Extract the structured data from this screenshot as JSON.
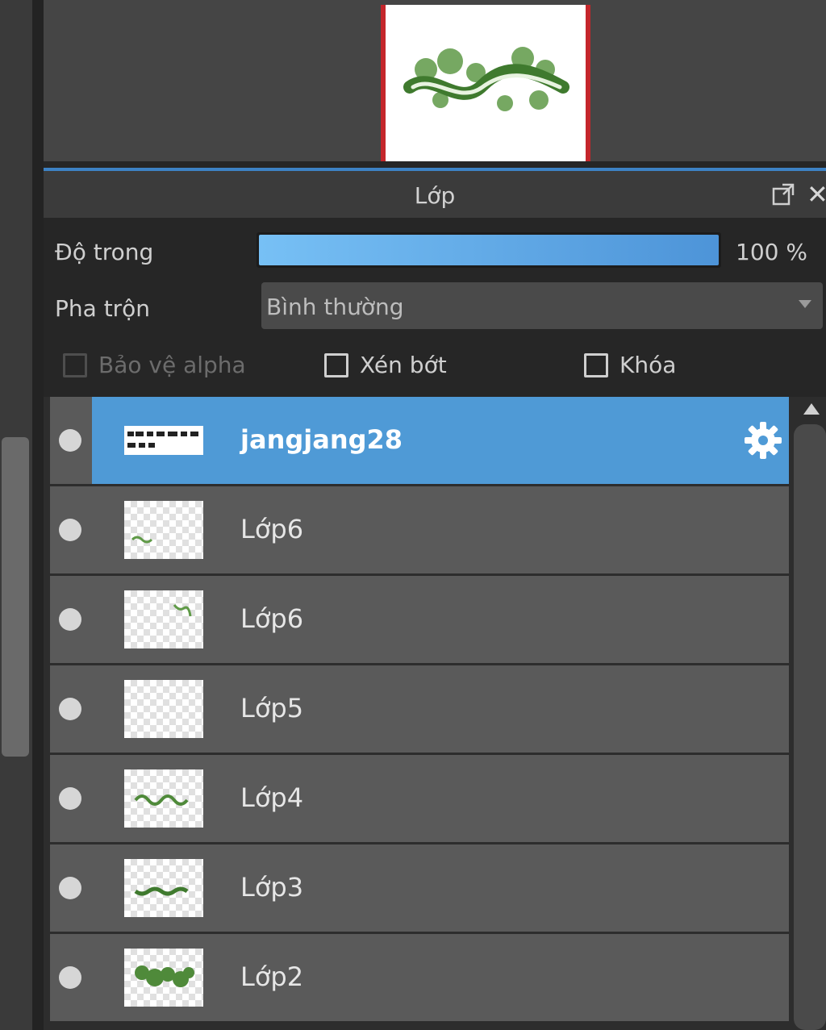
{
  "panel": {
    "title": "Lớp"
  },
  "controls": {
    "opacity_label": "Độ trong",
    "opacity_value": "100 %",
    "opacity_fraction": 1.0,
    "blend_label": "Pha trộn",
    "blend_value": "Bình thường",
    "protect_alpha_label": "Bảo vệ alpha",
    "protect_alpha_enabled": false,
    "protect_alpha_checked": false,
    "clip_label": "Xén bớt",
    "clip_checked": false,
    "lock_label": "Khóa",
    "lock_checked": false
  },
  "layers": [
    {
      "name": "jangjang28",
      "selected": true,
      "visible": true
    },
    {
      "name": "Lớp6",
      "selected": false,
      "visible": true
    },
    {
      "name": "Lớp6",
      "selected": false,
      "visible": true
    },
    {
      "name": "Lớp5",
      "selected": false,
      "visible": true
    },
    {
      "name": "Lớp4",
      "selected": false,
      "visible": true
    },
    {
      "name": "Lớp3",
      "selected": false,
      "visible": true
    },
    {
      "name": "Lớp2",
      "selected": false,
      "visible": true
    }
  ],
  "colors": {
    "accent": "#4f9ad6",
    "canvas_border": "#c4262b",
    "art_green": "#4f8a3a"
  },
  "icons": {
    "popout": "popout-icon",
    "close": "close-icon",
    "settings": "gear-icon",
    "visibility": "visibility-dot-icon"
  }
}
